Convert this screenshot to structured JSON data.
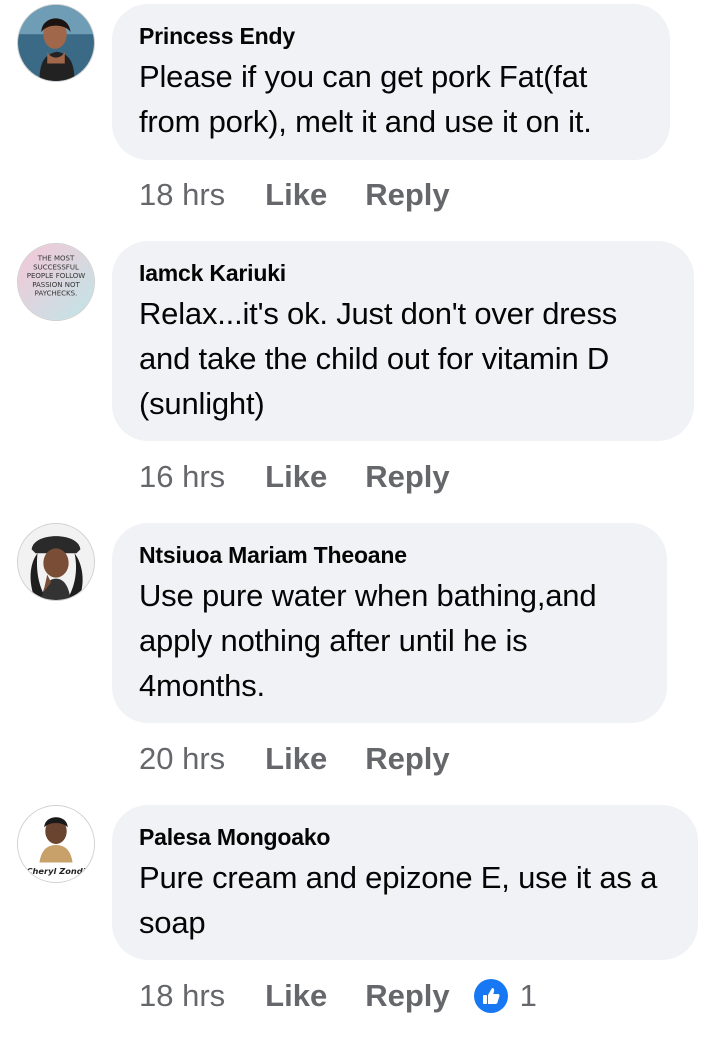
{
  "comments": [
    {
      "author": "Princess Endy",
      "text": "Please if you can get pork Fat(fat from pork), melt it and use it on it.",
      "time": "18 hrs",
      "like_label": "Like",
      "reply_label": "Reply",
      "avatar_icon": "profile-photo"
    },
    {
      "author": "Iamck Kariuki",
      "text": "Relax...it's ok. Just don't over dress and take the child out for vitamin D (sunlight)",
      "time": "16 hrs",
      "like_label": "Like",
      "reply_label": "Reply",
      "avatar_icon": "quote-image",
      "avatar_text": [
        "THE MOST",
        "SUCCESSFUL",
        "PEOPLE FOLLOW",
        "PASSION NOT",
        "PAYCHECKS."
      ]
    },
    {
      "author": "Ntsiuoa Mariam Theoane",
      "text": "Use pure water when bathing,and apply nothing after until he is 4months.",
      "time": "20 hrs",
      "like_label": "Like",
      "reply_label": "Reply",
      "avatar_icon": "profile-photo"
    },
    {
      "author": "Palesa Mongoako",
      "text": "Pure cream and epizone E, use it as a soap",
      "time": "18 hrs",
      "like_label": "Like",
      "reply_label": "Reply",
      "avatar_icon": "profile-photo",
      "avatar_text": "Cheryl Zondi",
      "reaction_icon": "thumbs-up-icon",
      "reaction_count": "1"
    }
  ],
  "colors": {
    "bubble": "#f0f2f5",
    "meta_text": "#65676b",
    "like_blue": "#1877f2"
  }
}
